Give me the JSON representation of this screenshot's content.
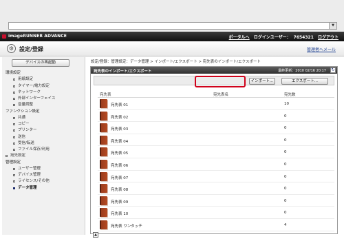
{
  "browser": {
    "address": ""
  },
  "header": {
    "brand": "imageRUNNER ADVANCE",
    "portal_link": "ポータルへ",
    "login_label": "ログインユーザー：",
    "user_id": "7654321",
    "logout": "ログアウト"
  },
  "titlebar": {
    "title": "設定/登録",
    "mail_link": "管理者へメール"
  },
  "sidebar": {
    "restart_button": "デバイスの再起動",
    "items": [
      {
        "label": "環境設定"
      },
      {
        "label": "用紙設定"
      },
      {
        "label": "タイマー/電力設定"
      },
      {
        "label": "ネットワーク"
      },
      {
        "label": "外部インターフェイス"
      },
      {
        "label": "音量調整"
      },
      {
        "label": "ファンクション設定"
      },
      {
        "label": "共通"
      },
      {
        "label": "コピー"
      },
      {
        "label": "プリンター"
      },
      {
        "label": "送信"
      },
      {
        "label": "受信/転送"
      },
      {
        "label": "ファイル保存/利用"
      },
      {
        "label": "宛先設定"
      },
      {
        "label": "管理設定"
      },
      {
        "label": "ユーザー管理"
      },
      {
        "label": "デバイス管理"
      },
      {
        "label": "ライセンス/その他"
      },
      {
        "label": "データ管理"
      }
    ]
  },
  "main": {
    "breadcrumb": "設定/登録：管理設定：データ管理 > インポート/エクスポート > 宛先表のインポート/エクスポート",
    "panel_title": "宛先表のインポート/エクスポート",
    "updated": "最終更新：2010 02/16 20:17",
    "import_button": "インポート...",
    "export_button": "エクスポート...",
    "columns": {
      "book": "宛先表",
      "name": "宛先表名",
      "count": "宛先数"
    },
    "rows": [
      {
        "book": "宛先表 01",
        "count": "10"
      },
      {
        "book": "宛先表 02",
        "count": "0"
      },
      {
        "book": "宛先表 03",
        "count": "0"
      },
      {
        "book": "宛先表 04",
        "count": "0"
      },
      {
        "book": "宛先表 05",
        "count": "0"
      },
      {
        "book": "宛先表 06",
        "count": "0"
      },
      {
        "book": "宛先表 07",
        "count": "0"
      },
      {
        "book": "宛先表 08",
        "count": "0"
      },
      {
        "book": "宛先表 09",
        "count": "0"
      },
      {
        "book": "宛先表 10",
        "count": "0"
      },
      {
        "book": "宛先表 ワンタッチ",
        "count": "4"
      }
    ]
  },
  "icons": {
    "title": "gear-icon",
    "refresh": "refresh-icon",
    "book": "address-book-icon",
    "top": "page-top-icon"
  },
  "colors": {
    "highlight": "#d0021b",
    "brand_mark": "#c8102e",
    "header_bg": "#1a1a1a"
  }
}
